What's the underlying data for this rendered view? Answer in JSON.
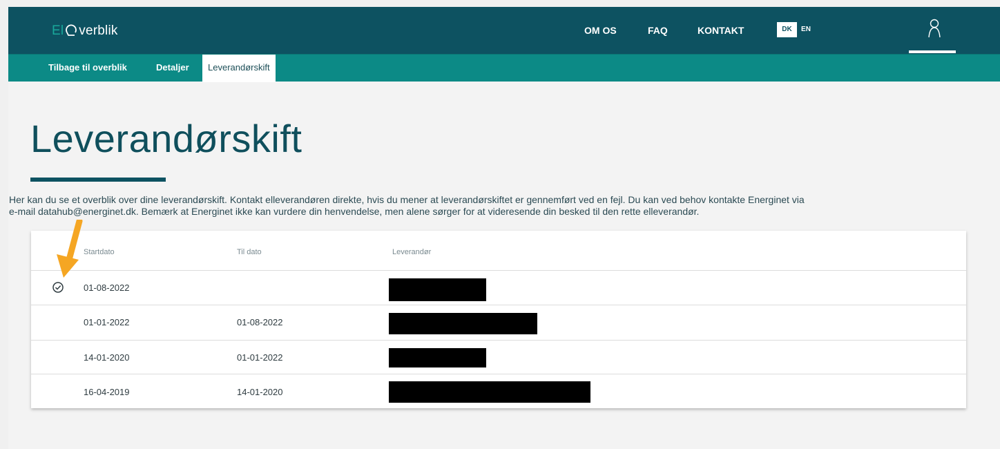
{
  "header": {
    "logo_prefix": "El",
    "logo_suffix": "verblik",
    "nav": [
      "OM OS",
      "FAQ",
      "KONTAKT"
    ],
    "lang_dk": "DK",
    "lang_en": "EN"
  },
  "subnav": {
    "back": "Tilbage til overblik",
    "details": "Detaljer",
    "supplier_switch": "Leverandørskift"
  },
  "main": {
    "title": "Leverandørskift",
    "intro_line1": "Her kan du se et overblik over dine leverandørskift. Kontakt elleverandøren direkte, hvis du mener at leverandørskiftet er gennemført ved en fejl. Du kan ved behov kontakte Energinet via",
    "intro_line2": "e-mail datahub@energinet.dk. Bemærk at Energinet ikke kan vurdere din henvendelse, men alene sørger for at videresende din besked til den rette elleverandør."
  },
  "table": {
    "headers": [
      "Startdato",
      "Til dato",
      "Leverandør"
    ],
    "rows": [
      {
        "start": "01-08-2022",
        "end": "",
        "active": true
      },
      {
        "start": "01-01-2022",
        "end": "01-08-2022",
        "active": false
      },
      {
        "start": "14-01-2020",
        "end": "01-01-2022",
        "active": false
      },
      {
        "start": "16-04-2019",
        "end": "14-01-2020",
        "active": false
      }
    ]
  },
  "colors": {
    "header_bg": "#0d5261",
    "subnav_bg": "#0c8a86",
    "accent_arrow": "#f5a623"
  },
  "icons": [
    "logo-q-icon",
    "user-icon",
    "check-circle-icon",
    "annotation-arrow-icon"
  ]
}
